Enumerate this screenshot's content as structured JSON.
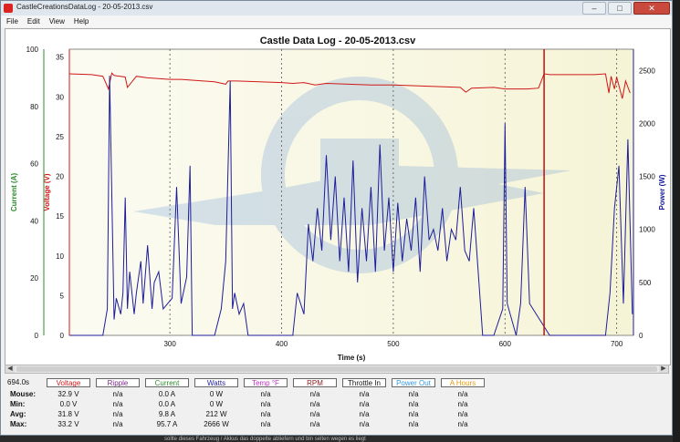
{
  "window": {
    "title": "CastleCreationsDataLog - 20-05-2013.csv",
    "buttons": {
      "minimize": "–",
      "maximize": "□",
      "close": "✕"
    }
  },
  "menu": [
    "File",
    "Edit",
    "View",
    "Help"
  ],
  "chart_data": {
    "type": "line",
    "title": "Castle Data Log - 20-05-2013.csv",
    "xlabel": "Time (s)",
    "xlim": [
      210,
      715
    ],
    "xticks": [
      300,
      400,
      500,
      600,
      700
    ],
    "axes": {
      "current": {
        "label": "Current (A)",
        "color": "#2e8b2e",
        "ticks": [
          0,
          20,
          40,
          60,
          80,
          100
        ],
        "range": [
          0,
          100
        ]
      },
      "voltage": {
        "label": "Voltage (V)",
        "color": "#d01818",
        "ticks": [
          0,
          5,
          10,
          15,
          20,
          25,
          30,
          35
        ],
        "range": [
          0,
          36
        ]
      },
      "power": {
        "label": "Power (W)",
        "color": "#1d1d9a",
        "ticks": [
          0,
          500,
          1000,
          1500,
          2000,
          2500
        ],
        "range": [
          0,
          2700
        ]
      }
    },
    "grid": true,
    "cursor_time": 635,
    "series": [
      {
        "name": "Voltage",
        "axis": "voltage",
        "color": "#d01818",
        "x": [
          210,
          230,
          240,
          245,
          248,
          250,
          260,
          262,
          270,
          280,
          290,
          300,
          310,
          320,
          340,
          350,
          352,
          360,
          380,
          400,
          410,
          420,
          430,
          440,
          460,
          480,
          500,
          520,
          540,
          560,
          565,
          570,
          590,
          600,
          620,
          630,
          635,
          640,
          660,
          680,
          690,
          693,
          695,
          698,
          700,
          705,
          708,
          712
        ],
        "values": [
          32.9,
          32.8,
          32.6,
          31.0,
          33.0,
          32.7,
          32.5,
          31.2,
          32.6,
          32.4,
          32.3,
          32.2,
          32.2,
          32.1,
          31.9,
          31.6,
          32.0,
          32.0,
          31.9,
          31.8,
          31.7,
          31.8,
          31.5,
          31.7,
          31.6,
          31.5,
          31.5,
          31.4,
          31.3,
          31.2,
          30.6,
          31.1,
          31.2,
          31.0,
          31.0,
          31.1,
          32.9,
          32.8,
          32.8,
          32.8,
          32.9,
          30.5,
          32.6,
          31.0,
          32.5,
          29.8,
          32.0,
          30.5
        ]
      },
      {
        "name": "Watts",
        "axis": "power",
        "color": "#1d1d9a",
        "x": [
          210,
          240,
          244,
          246,
          250,
          252,
          256,
          258,
          260,
          262,
          264,
          268,
          270,
          274,
          276,
          280,
          284,
          286,
          290,
          294,
          298,
          302,
          306,
          310,
          315,
          318,
          320,
          330,
          340,
          346,
          350,
          354,
          356,
          358,
          362,
          366,
          370,
          400,
          410,
          414,
          420,
          424,
          428,
          432,
          436,
          440,
          444,
          448,
          452,
          456,
          460,
          464,
          468,
          472,
          476,
          480,
          484,
          488,
          492,
          496,
          500,
          504,
          508,
          512,
          516,
          520,
          524,
          528,
          532,
          536,
          540,
          544,
          548,
          552,
          556,
          560,
          564,
          568,
          572,
          576,
          580,
          590,
          598,
          600,
          602,
          610,
          614,
          618,
          622,
          640,
          690,
          694,
          698,
          702,
          706,
          710,
          714
        ],
        "values": [
          0,
          0,
          250,
          2450,
          150,
          350,
          200,
          400,
          1300,
          250,
          600,
          200,
          400,
          700,
          300,
          850,
          250,
          500,
          600,
          250,
          300,
          350,
          1400,
          300,
          550,
          1600,
          0,
          0,
          0,
          250,
          700,
          2400,
          250,
          400,
          200,
          300,
          0,
          0,
          0,
          400,
          200,
          1050,
          700,
          1200,
          800,
          1700,
          900,
          1500,
          700,
          1300,
          600,
          1650,
          500,
          1200,
          700,
          1400,
          600,
          1800,
          800,
          1300,
          600,
          1250,
          700,
          1100,
          800,
          1300,
          600,
          1500,
          900,
          1000,
          800,
          1200,
          700,
          1000,
          900,
          1400,
          800,
          700,
          1200,
          600,
          0,
          0,
          250,
          2000,
          300,
          0,
          300,
          1400,
          300,
          0,
          0,
          400,
          1200,
          1600,
          300,
          1850,
          200
        ]
      }
    ],
    "current_profile": {
      "name": "Current",
      "axis": "current",
      "color": "#2e8b2e"
    }
  },
  "stats": {
    "time": "694.0s",
    "headers": [
      {
        "label": "Voltage",
        "color": "#d01818"
      },
      {
        "label": "Ripple",
        "color": "#7a2a8a"
      },
      {
        "label": "Current",
        "color": "#2e8b2e"
      },
      {
        "label": "Watts",
        "color": "#1d1d9a"
      },
      {
        "label": "Temp °F",
        "color": "#c030c0"
      },
      {
        "label": "RPM",
        "color": "#8a1c1c"
      },
      {
        "label": "Throttle In",
        "color": "#111111"
      },
      {
        "label": "Power Out",
        "color": "#3399dd"
      },
      {
        "label": "A Hours",
        "color": "#e69a10"
      }
    ],
    "rows": [
      {
        "label": "Mouse:",
        "cells": [
          "32.9 V",
          "n/a",
          "0.0 A",
          "0 W",
          "n/a",
          "n/a",
          "n/a",
          "n/a",
          "n/a"
        ]
      },
      {
        "label": "Min:",
        "cells": [
          "0.0 V",
          "n/a",
          "0.0 A",
          "0 W",
          "n/a",
          "n/a",
          "n/a",
          "n/a",
          "n/a"
        ]
      },
      {
        "label": "Avg:",
        "cells": [
          "31.8 V",
          "n/a",
          "9.8 A",
          "212 W",
          "n/a",
          "n/a",
          "n/a",
          "n/a",
          "n/a"
        ]
      },
      {
        "label": "Max:",
        "cells": [
          "33.2 V",
          "n/a",
          "95.7 A",
          "2666 W",
          "n/a",
          "n/a",
          "n/a",
          "n/a",
          "n/a"
        ]
      }
    ]
  },
  "below_text": "sollte dieses Fahrzeug / Akkus das doppelte abliefern und bin selten wegen es liegt"
}
